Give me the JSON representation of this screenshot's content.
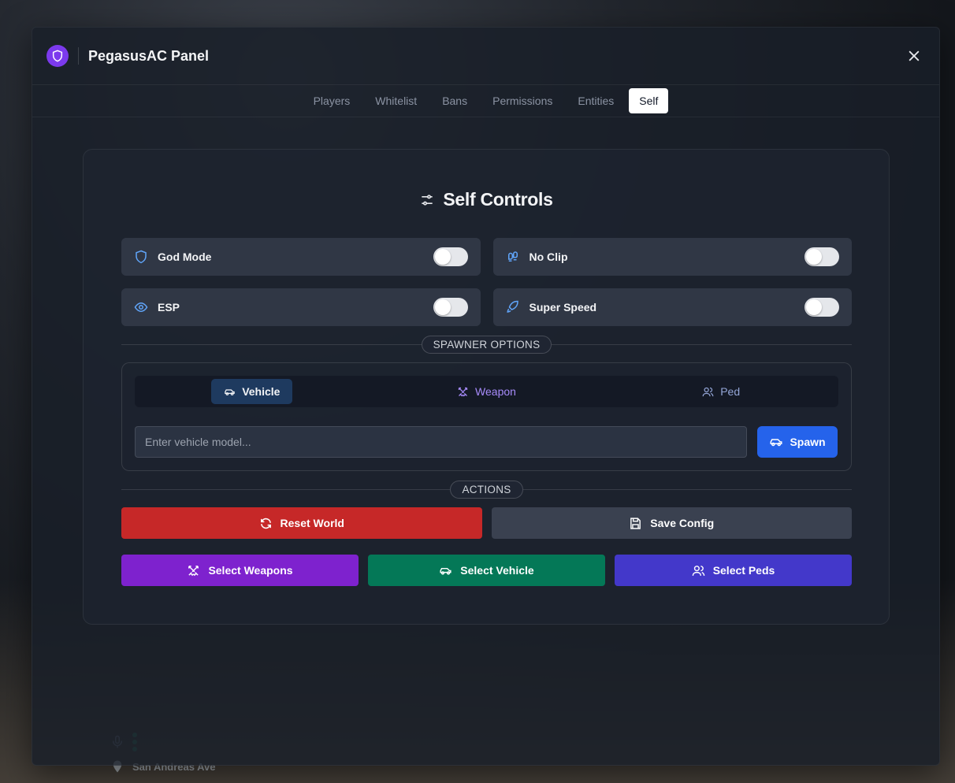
{
  "app": {
    "title": "PegasusAC Panel"
  },
  "tabs": [
    {
      "label": "Players",
      "active": false
    },
    {
      "label": "Whitelist",
      "active": false
    },
    {
      "label": "Bans",
      "active": false
    },
    {
      "label": "Permissions",
      "active": false
    },
    {
      "label": "Entities",
      "active": false
    },
    {
      "label": "Self",
      "active": true
    }
  ],
  "self": {
    "title": "Self Controls",
    "toggles": [
      {
        "label": "God Mode",
        "icon": "shield-icon",
        "on": false
      },
      {
        "label": "No Clip",
        "icon": "footprints-icon",
        "on": false
      },
      {
        "label": "ESP",
        "icon": "eye-icon",
        "on": false
      },
      {
        "label": "Super Speed",
        "icon": "rocket-icon",
        "on": false
      }
    ],
    "spawner": {
      "section_label": "SPAWNER OPTIONS",
      "tabs": [
        {
          "label": "Vehicle",
          "icon": "car-icon",
          "active": true
        },
        {
          "label": "Weapon",
          "icon": "swords-icon",
          "active": false
        },
        {
          "label": "Ped",
          "icon": "users-icon",
          "active": false
        }
      ],
      "input_placeholder": "Enter vehicle model...",
      "input_value": "",
      "spawn_label": "Spawn"
    },
    "actions": {
      "section_label": "ACTIONS",
      "reset_world": "Reset World",
      "save_config": "Save Config",
      "select_weapons": "Select Weapons",
      "select_vehicle": "Select Vehicle",
      "select_peds": "Select Peds"
    }
  },
  "hud": {
    "street": "San Andreas Ave"
  },
  "colors": {
    "accent_purple": "#7c3aed",
    "reset": "#c62828",
    "save": "#3a4150",
    "weapons": "#7e22ce",
    "vehicle": "#047857",
    "peds": "#4338ca",
    "spawn": "#2563eb"
  }
}
